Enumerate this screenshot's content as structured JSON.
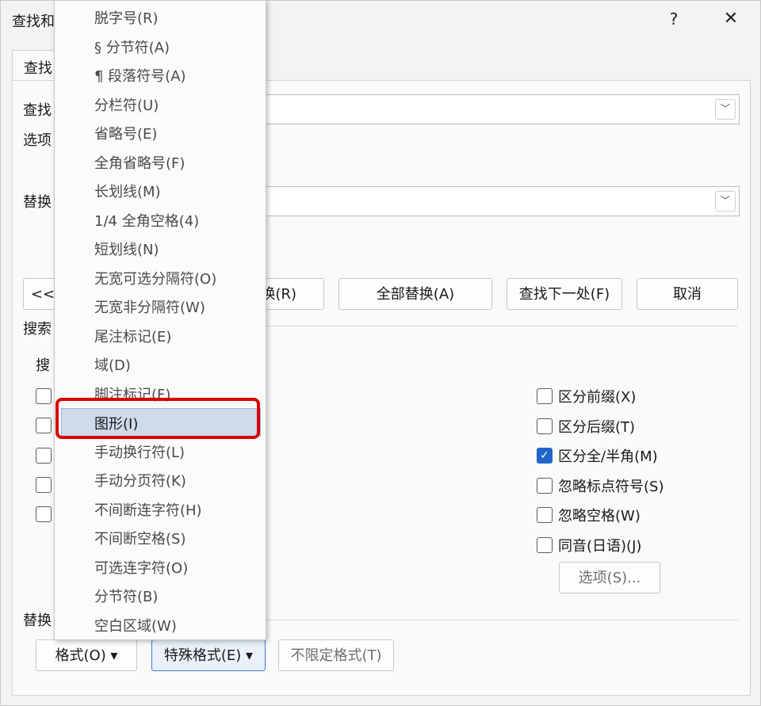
{
  "dialog": {
    "title": "查找和",
    "help_label": "?",
    "close_label": "✕",
    "tab_label": "查找"
  },
  "find": {
    "label": "查找",
    "options_label": "选项",
    "dropdown_arrow": "﹀"
  },
  "replace": {
    "label": "替换",
    "dropdown_arrow": "﹀"
  },
  "buttons": {
    "less": "<<",
    "replace": "换(R)",
    "replace_all": "全部替换(A)",
    "find_next": "查找下一处(F)",
    "cancel": "取消",
    "options": "选项(S)...",
    "format": "格式(O) ▾",
    "special_format": "特殊格式(E) ▾",
    "no_format": "不限定格式(T)"
  },
  "search_section": {
    "title": "搜索",
    "sub": "搜"
  },
  "right_options": [
    {
      "label": "区分前缀(X)",
      "checked": false
    },
    {
      "label": "区分后缀(T)",
      "checked": false
    },
    {
      "label": "区分全/半角(M)",
      "checked": true
    },
    {
      "label": "忽略标点符号(S)",
      "checked": false
    },
    {
      "label": "忽略空格(W)",
      "checked": false
    },
    {
      "label": "同音(日语)(J)",
      "checked": false
    }
  ],
  "replace_section_label": "替换",
  "menu_items": [
    "脱字号(R)",
    "§ 分节符(A)",
    "¶ 段落符号(A)",
    "分栏符(U)",
    "省略号(E)",
    "全角省略号(F)",
    "长划线(M)",
    "1/4 全角空格(4)",
    "短划线(N)",
    "无宽可选分隔符(O)",
    "无宽非分隔符(W)",
    "尾注标记(E)",
    "域(D)",
    "脚注标记(F)",
    "图形(I)",
    "手动换行符(L)",
    "手动分页符(K)",
    "不间断连字符(H)",
    "不间断空格(S)",
    "可选连字符(O)",
    "分节符(B)",
    "空白区域(W)"
  ],
  "selected_menu_item": "图形(I)",
  "colors": {
    "highlight": "#d90000",
    "check_blue": "#1f66c8",
    "selection_bg": "#cfdbeb"
  }
}
